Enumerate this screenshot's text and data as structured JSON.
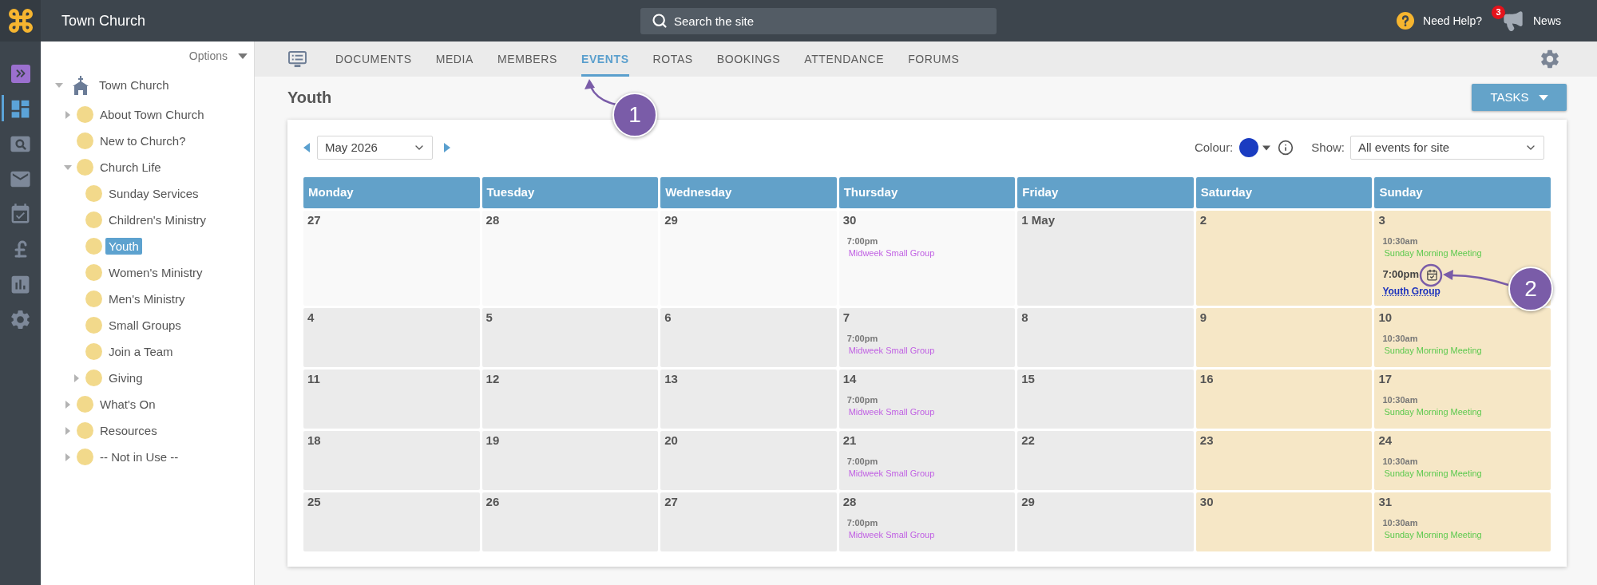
{
  "header": {
    "title": "Town Church",
    "search": {
      "placeholder": "Search the site"
    },
    "help": "Need Help?",
    "news": {
      "label": "News",
      "badge": "3"
    }
  },
  "rail": {
    "items": [
      {
        "selected": false
      },
      {
        "selected": true
      },
      {
        "selected": false
      },
      {
        "selected": false
      },
      {
        "selected": false
      },
      {
        "selected": false
      },
      {
        "selected": false
      },
      {
        "selected": false
      }
    ]
  },
  "sidebar": {
    "options": "Options",
    "tree": {
      "label": "Town Church",
      "expanded": true,
      "selected": false,
      "children": [
        {
          "label": "About Town Church",
          "expanded": false,
          "selected": false
        },
        {
          "label": "New to Church?",
          "selected": false
        },
        {
          "label": "Church Life",
          "expanded": true,
          "selected": false,
          "children": [
            {
              "label": "Sunday Services",
              "selected": false
            },
            {
              "label": "Children's Ministry",
              "selected": false
            },
            {
              "label": "Youth",
              "selected": true
            },
            {
              "label": "Women's Ministry",
              "selected": false
            },
            {
              "label": "Men's Ministry",
              "selected": false
            },
            {
              "label": "Small Groups",
              "selected": false
            },
            {
              "label": "Join a Team",
              "selected": false
            },
            {
              "label": "Giving",
              "expanded": false,
              "selected": false
            }
          ]
        },
        {
          "label": "What's On",
          "expanded": false,
          "selected": false
        },
        {
          "label": "Resources",
          "expanded": false,
          "selected": false
        },
        {
          "label": "-- Not in Use --",
          "expanded": false,
          "selected": false
        }
      ]
    }
  },
  "tabs": [
    {
      "label": "DOCUMENTS",
      "selected": false
    },
    {
      "label": "MEDIA",
      "selected": false
    },
    {
      "label": "MEMBERS",
      "selected": false
    },
    {
      "label": "EVENTS",
      "selected": true
    },
    {
      "label": "ROTAS",
      "selected": false
    },
    {
      "label": "BOOKINGS",
      "selected": false
    },
    {
      "label": "ATTENDANCE",
      "selected": false
    },
    {
      "label": "FORUMS",
      "selected": false
    }
  ],
  "page": {
    "title": "Youth",
    "tasks": "TASKS"
  },
  "calendar": {
    "month": "May 2026",
    "colour": {
      "label": "Colour:",
      "color": "#1a3cc1"
    },
    "show": {
      "label": "Show:",
      "value": "All events for site"
    },
    "weekdays": [
      "Monday",
      "Tuesday",
      "Wednesday",
      "Thursday",
      "Friday",
      "Saturday",
      "Sunday"
    ],
    "weeks": [
      {
        "days": [
          {
            "date": "27",
            "kind": "outside"
          },
          {
            "date": "28",
            "kind": "outside"
          },
          {
            "date": "29",
            "kind": "outside"
          },
          {
            "date": "30",
            "kind": "outside",
            "events": [
              {
                "time": "7:00pm",
                "title": "Midweek Small Group",
                "color": "#c061e3",
                "kind": "standard"
              }
            ]
          },
          {
            "date": "1 May",
            "kind": "weekday"
          },
          {
            "date": "2",
            "kind": "weekend"
          },
          {
            "date": "3",
            "kind": "weekend",
            "events": [
              {
                "time": "10:30am",
                "title": "Sunday Morning Meeting",
                "color": "#5cc94e",
                "kind": "standard"
              },
              {
                "time": "7:00pm",
                "title": "Youth Group",
                "color": "#1b31bd",
                "kind": "own"
              }
            ]
          }
        ]
      },
      {
        "days": [
          {
            "date": "4",
            "kind": "weekday"
          },
          {
            "date": "5",
            "kind": "weekday"
          },
          {
            "date": "6",
            "kind": "weekday"
          },
          {
            "date": "7",
            "kind": "weekday",
            "events": [
              {
                "time": "7:00pm",
                "title": "Midweek Small Group",
                "color": "#c061e3",
                "kind": "standard"
              }
            ]
          },
          {
            "date": "8",
            "kind": "weekday"
          },
          {
            "date": "9",
            "kind": "weekend"
          },
          {
            "date": "10",
            "kind": "weekend",
            "events": [
              {
                "time": "10:30am",
                "title": "Sunday Morning Meeting",
                "color": "#5cc94e",
                "kind": "standard"
              }
            ]
          }
        ]
      },
      {
        "days": [
          {
            "date": "11",
            "kind": "weekday"
          },
          {
            "date": "12",
            "kind": "weekday"
          },
          {
            "date": "13",
            "kind": "weekday"
          },
          {
            "date": "14",
            "kind": "weekday",
            "events": [
              {
                "time": "7:00pm",
                "title": "Midweek Small Group",
                "color": "#c061e3",
                "kind": "standard"
              }
            ]
          },
          {
            "date": "15",
            "kind": "weekday"
          },
          {
            "date": "16",
            "kind": "weekend"
          },
          {
            "date": "17",
            "kind": "weekend",
            "events": [
              {
                "time": "10:30am",
                "title": "Sunday Morning Meeting",
                "color": "#5cc94e",
                "kind": "standard"
              }
            ]
          }
        ]
      },
      {
        "days": [
          {
            "date": "18",
            "kind": "weekday"
          },
          {
            "date": "19",
            "kind": "weekday"
          },
          {
            "date": "20",
            "kind": "weekday"
          },
          {
            "date": "21",
            "kind": "weekday",
            "events": [
              {
                "time": "7:00pm",
                "title": "Midweek Small Group",
                "color": "#c061e3",
                "kind": "standard"
              }
            ]
          },
          {
            "date": "22",
            "kind": "weekday"
          },
          {
            "date": "23",
            "kind": "weekend"
          },
          {
            "date": "24",
            "kind": "weekend",
            "events": [
              {
                "time": "10:30am",
                "title": "Sunday Morning Meeting",
                "color": "#5cc94e",
                "kind": "standard"
              }
            ]
          }
        ]
      },
      {
        "days": [
          {
            "date": "25",
            "kind": "weekday"
          },
          {
            "date": "26",
            "kind": "weekday"
          },
          {
            "date": "27",
            "kind": "weekday"
          },
          {
            "date": "28",
            "kind": "weekday",
            "events": [
              {
                "time": "7:00pm",
                "title": "Midweek Small Group",
                "color": "#c061e3",
                "kind": "standard"
              }
            ]
          },
          {
            "date": "29",
            "kind": "weekday"
          },
          {
            "date": "30",
            "kind": "weekend"
          },
          {
            "date": "31",
            "kind": "weekend",
            "events": [
              {
                "time": "10:30am",
                "title": "Sunday Morning Meeting",
                "color": "#5cc94e",
                "kind": "standard"
              }
            ]
          }
        ]
      }
    ]
  },
  "annotations": [
    {
      "number": "1"
    },
    {
      "number": "2"
    }
  ]
}
